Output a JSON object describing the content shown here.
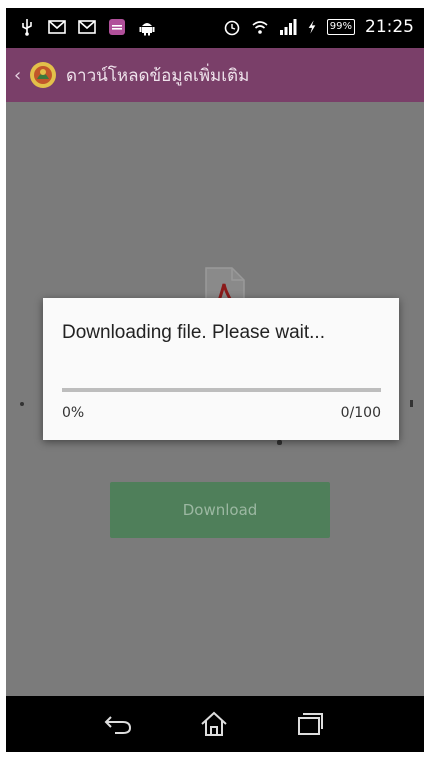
{
  "status_bar": {
    "time": "21:25",
    "battery_percent": "99%",
    "left_icons": [
      "usb-icon",
      "gmail-icon",
      "gmail-icon",
      "app-notification-icon",
      "android-icon"
    ],
    "right_icons": [
      "alarm-icon",
      "wifi-icon",
      "signal-icon",
      "charging-icon",
      "battery-icon"
    ]
  },
  "action_bar": {
    "title": "ดาวน์โหลดข้อมูลเพิ่มเติม",
    "background": "#7a3f69"
  },
  "content": {
    "download_button_label": "Download",
    "button_color": "#4f7f5a"
  },
  "dialog": {
    "message": "Downloading file. Please wait...",
    "progress_percent_label": "0%",
    "progress_count_label": "0/100",
    "progress_fraction": 0,
    "accent": "#33b5e5"
  },
  "nav_bar": {
    "buttons": [
      "back-icon",
      "home-icon",
      "recent-apps-icon"
    ]
  }
}
